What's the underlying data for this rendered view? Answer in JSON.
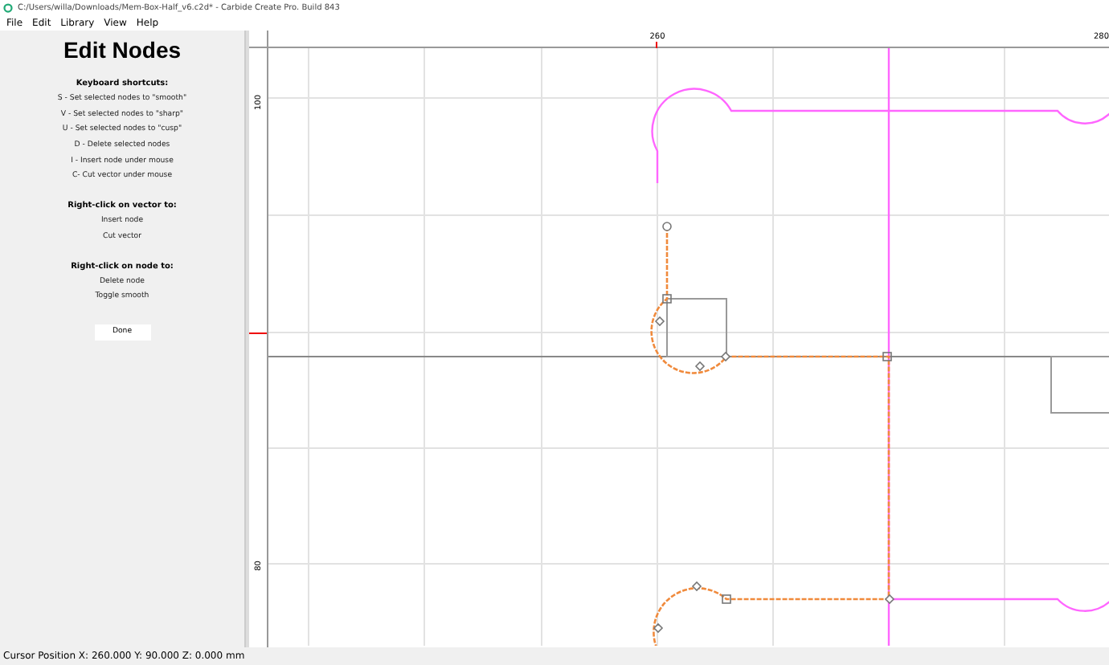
{
  "window": {
    "title": "C:/Users/willa/Downloads/Mem-Box-Half_v6.c2d* - Carbide Create Pro. Build 843"
  },
  "menu": [
    "File",
    "Edit",
    "Library",
    "View",
    "Help"
  ],
  "panel": {
    "title": "Edit Nodes",
    "sections": [
      {
        "heading": "Keyboard shortcuts:",
        "lines": [
          "S - Set selected nodes to \"smooth\"",
          "V - Set selected nodes to \"sharp\"",
          "U - Set selected nodes to \"cusp\"",
          "D - Delete selected nodes",
          "I - Insert node under mouse",
          "C- Cut vector under mouse"
        ]
      },
      {
        "heading": "Right-click on vector to:",
        "lines": [
          "Insert node",
          "Cut vector"
        ]
      },
      {
        "heading": "Right-click on node to:",
        "lines": [
          "Delete node",
          "Toggle smooth"
        ]
      }
    ],
    "button": "Done"
  },
  "ruler": {
    "top_labels": [
      "260",
      "280"
    ],
    "left_labels": [
      "100",
      "80"
    ]
  },
  "status_bar": "Cursor Position X: 260.000 Y: 90.000 Z: 0.000 mm"
}
